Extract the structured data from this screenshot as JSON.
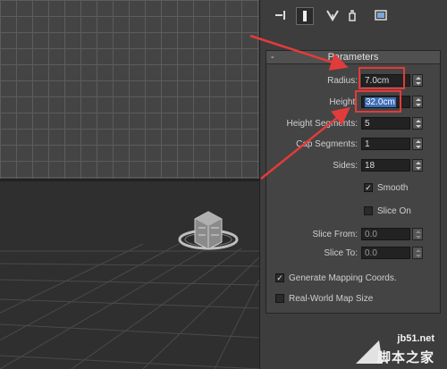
{
  "toolbar": {
    "icons": [
      "create-icon",
      "modify-icon",
      "hierarchy-icon",
      "motion-icon",
      "display-icon"
    ]
  },
  "rollout": {
    "title": "Parameters",
    "collapse_symbol": "-"
  },
  "params": {
    "radius": {
      "label": "Radius:",
      "value": "7.0cm"
    },
    "height": {
      "label": "Height:",
      "value": "32.0cm"
    },
    "height_segments": {
      "label": "Height Segments:",
      "value": "5"
    },
    "cap_segments": {
      "label": "Cap Segments:",
      "value": "1"
    },
    "sides": {
      "label": "Sides:",
      "value": "18"
    },
    "smooth": {
      "label": "Smooth",
      "checked": true
    },
    "slice_on": {
      "label": "Slice On",
      "checked": false
    },
    "slice_from": {
      "label": "Slice From:",
      "value": "0.0"
    },
    "slice_to": {
      "label": "Slice To:",
      "value": "0.0"
    },
    "gen_mapping": {
      "label": "Generate Mapping Coords.",
      "checked": true
    },
    "real_world": {
      "label": "Real-World Map Size",
      "checked": false
    }
  },
  "annotation_color": "#e23b3b",
  "watermark": {
    "url": "jb51.net",
    "cn": "脚本之家"
  }
}
